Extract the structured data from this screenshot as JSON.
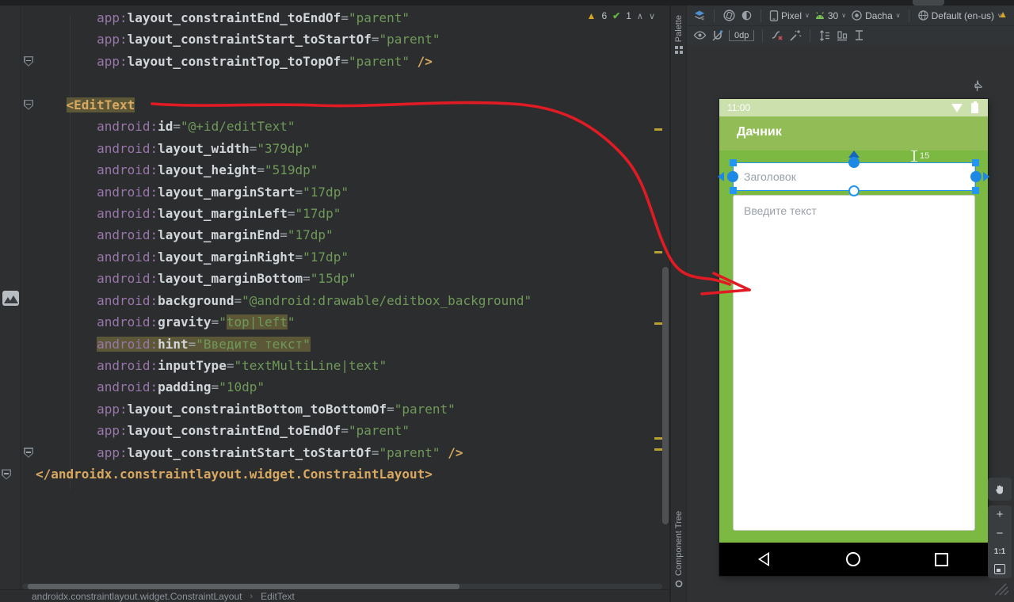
{
  "inspection": {
    "warnings": "6",
    "ok": "1"
  },
  "editor": {
    "breadcrumb": {
      "items": [
        "androidx.constraintlayout.widget.ConstraintLayout",
        "EditText"
      ],
      "separator": "›"
    },
    "lines": [
      {
        "t": [
          [
            "ind",
            "        "
          ],
          [
            "ns",
            "app:"
          ],
          [
            "attr",
            "layout_constraintEnd_toEndOf"
          ],
          [
            "eq",
            "="
          ],
          [
            "str",
            "\"parent\""
          ]
        ]
      },
      {
        "t": [
          [
            "ind",
            "        "
          ],
          [
            "ns",
            "app:"
          ],
          [
            "attr",
            "layout_constraintStart_toStartOf"
          ],
          [
            "eq",
            "="
          ],
          [
            "str",
            "\"parent\""
          ]
        ]
      },
      {
        "g": "fold",
        "t": [
          [
            "ind",
            "        "
          ],
          [
            "ns",
            "app:"
          ],
          [
            "attr",
            "layout_constraintTop_toTopOf"
          ],
          [
            "eq",
            "="
          ],
          [
            "str",
            "\"parent\""
          ],
          [
            "pl",
            " "
          ],
          [
            "tag",
            "/>"
          ]
        ]
      },
      {
        "t": []
      },
      {
        "g": "fold",
        "t": [
          [
            "ind",
            "    "
          ],
          [
            "tag hl",
            "<EditText"
          ]
        ]
      },
      {
        "t": [
          [
            "ind",
            "        "
          ],
          [
            "ns",
            "android:"
          ],
          [
            "attr",
            "id"
          ],
          [
            "eq",
            "="
          ],
          [
            "str",
            "\"@+id/editText\""
          ]
        ]
      },
      {
        "t": [
          [
            "ind",
            "        "
          ],
          [
            "ns",
            "android:"
          ],
          [
            "attr",
            "layout_width"
          ],
          [
            "eq",
            "="
          ],
          [
            "str",
            "\"379dp\""
          ]
        ]
      },
      {
        "t": [
          [
            "ind",
            "        "
          ],
          [
            "ns",
            "android:"
          ],
          [
            "attr",
            "layout_height"
          ],
          [
            "eq",
            "="
          ],
          [
            "str",
            "\"519dp\""
          ]
        ]
      },
      {
        "t": [
          [
            "ind",
            "        "
          ],
          [
            "ns",
            "android:"
          ],
          [
            "attr",
            "layout_marginStart"
          ],
          [
            "eq",
            "="
          ],
          [
            "str",
            "\"17dp\""
          ]
        ]
      },
      {
        "t": [
          [
            "ind",
            "        "
          ],
          [
            "ns",
            "android:"
          ],
          [
            "attr",
            "layout_marginLeft"
          ],
          [
            "eq",
            "="
          ],
          [
            "str",
            "\"17dp\""
          ]
        ]
      },
      {
        "t": [
          [
            "ind",
            "        "
          ],
          [
            "ns",
            "android:"
          ],
          [
            "attr",
            "layout_marginEnd"
          ],
          [
            "eq",
            "="
          ],
          [
            "str",
            "\"17dp\""
          ]
        ]
      },
      {
        "t": [
          [
            "ind",
            "        "
          ],
          [
            "ns",
            "android:"
          ],
          [
            "attr",
            "layout_marginRight"
          ],
          [
            "eq",
            "="
          ],
          [
            "str",
            "\"17dp\""
          ]
        ]
      },
      {
        "t": [
          [
            "ind",
            "        "
          ],
          [
            "ns",
            "android:"
          ],
          [
            "attr",
            "layout_marginBottom"
          ],
          [
            "eq",
            "="
          ],
          [
            "str",
            "\"15dp\""
          ]
        ]
      },
      {
        "t": [
          [
            "ind",
            "        "
          ],
          [
            "ns",
            "android:"
          ],
          [
            "attr",
            "background"
          ],
          [
            "eq",
            "="
          ],
          [
            "str",
            "\"@android:drawable/editbox_background\""
          ]
        ]
      },
      {
        "t": [
          [
            "ind",
            "        "
          ],
          [
            "ns",
            "android:"
          ],
          [
            "attr",
            "gravity"
          ],
          [
            "eq",
            "="
          ],
          [
            "str",
            "\""
          ],
          [
            "str hl",
            "top|left"
          ],
          [
            "str",
            "\""
          ]
        ]
      },
      {
        "t": [
          [
            "ind",
            "        "
          ],
          [
            "ns hl",
            "android:"
          ],
          [
            "attr hl",
            "hint"
          ],
          [
            "eq hl",
            "="
          ],
          [
            "str hl",
            "\"Введите текст\""
          ]
        ]
      },
      {
        "t": [
          [
            "ind",
            "        "
          ],
          [
            "ns",
            "android:"
          ],
          [
            "attr",
            "inputType"
          ],
          [
            "eq",
            "="
          ],
          [
            "str",
            "\"textMultiLine|text\""
          ]
        ]
      },
      {
        "t": [
          [
            "ind",
            "        "
          ],
          [
            "ns",
            "android:"
          ],
          [
            "attr",
            "padding"
          ],
          [
            "eq",
            "="
          ],
          [
            "str",
            "\"10dp\""
          ]
        ]
      },
      {
        "t": [
          [
            "ind",
            "        "
          ],
          [
            "ns",
            "app:"
          ],
          [
            "attr",
            "layout_constraintBottom_toBottomOf"
          ],
          [
            "eq",
            "="
          ],
          [
            "str",
            "\"parent\""
          ]
        ]
      },
      {
        "t": [
          [
            "ind",
            "        "
          ],
          [
            "ns",
            "app:"
          ],
          [
            "attr",
            "layout_constraintEnd_toEndOf"
          ],
          [
            "eq",
            "="
          ],
          [
            "str",
            "\"parent\""
          ]
        ]
      },
      {
        "g": "fold",
        "t": [
          [
            "ind",
            "        "
          ],
          [
            "ns",
            "app:"
          ],
          [
            "attr",
            "layout_constraintStart_toStartOf"
          ],
          [
            "eq",
            "="
          ],
          [
            "str",
            "\"parent\""
          ],
          [
            "pl",
            " "
          ],
          [
            "tag",
            "/>"
          ]
        ]
      },
      {
        "g": "fold-edge",
        "t": [
          [
            "tag",
            "</androidx.constraintlayout.widget.ConstraintLayout>"
          ]
        ]
      }
    ]
  },
  "toolbar": {
    "device": "Pixel",
    "api": "30",
    "theme": "Dacha",
    "locale": "Default (en-us)",
    "default_margin": "0dp",
    "help": "?"
  },
  "tabs": {
    "palette": "Palette",
    "component_tree": "Component Tree"
  },
  "preview": {
    "status_time": "11:00",
    "app_title": "Дачник",
    "title_hint": "Заголовок",
    "text_hint": "Введите текст",
    "margin_value": "15"
  },
  "zoom_controls": {
    "zoom_in": "+",
    "zoom_out": "−",
    "actual_size": "1:1"
  },
  "colors": {
    "accent_blue": "#2196f3",
    "annotation_red": "#e01b24",
    "body_green": "#7cb942",
    "appbar_green": "#92bd56",
    "statusbar_green": "#cbe0ac",
    "highlight_olive": "#5c5837",
    "warning_yellow": "#d8a526",
    "string_green": "#6f9959",
    "namespace_purple": "#9876aa",
    "tag_yellow": "#d9a860"
  }
}
